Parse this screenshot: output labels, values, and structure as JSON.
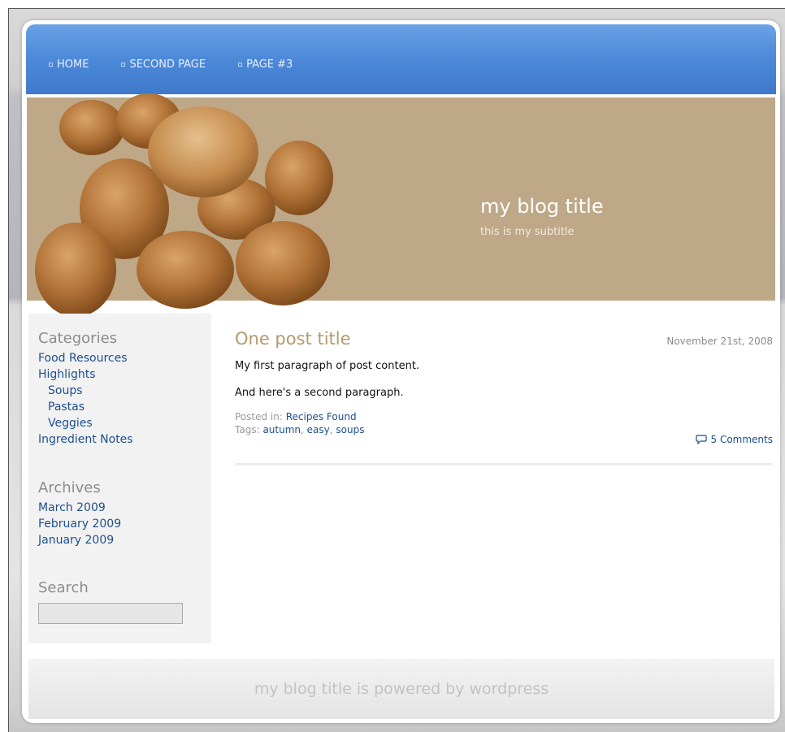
{
  "nav": {
    "items": [
      {
        "label": "HOME"
      },
      {
        "label": "SECOND PAGE"
      },
      {
        "label": "PAGE #3"
      }
    ]
  },
  "header": {
    "title": "my blog title",
    "subtitle": "this is my subtitle"
  },
  "sidebar": {
    "categories": {
      "title": "Categories",
      "items": [
        {
          "label": "Food Resources",
          "sub": false
        },
        {
          "label": "Highlights",
          "sub": false
        },
        {
          "label": "Soups",
          "sub": true
        },
        {
          "label": "Pastas",
          "sub": true
        },
        {
          "label": "Veggies",
          "sub": true
        },
        {
          "label": "Ingredient Notes",
          "sub": false
        }
      ]
    },
    "archives": {
      "title": "Archives",
      "items": [
        {
          "label": "March 2009"
        },
        {
          "label": "February 2009"
        },
        {
          "label": "January 2009"
        }
      ]
    },
    "search": {
      "title": "Search",
      "value": ""
    }
  },
  "post": {
    "title": "One post title",
    "date": "November 21st, 2008",
    "paragraphs": [
      "My first paragraph of post content.",
      "And here's a second paragraph."
    ],
    "posted_in_label": "Posted in:",
    "category": "Recipes Found",
    "tags_label": "Tags:",
    "tags": [
      "autumn",
      "easy",
      "soups"
    ],
    "comments": "5 Comments"
  },
  "footer": {
    "text": "my blog title is powered by wordpress"
  },
  "colors": {
    "nav_blue": "#4e8bd9",
    "banner_tan": "#bea887",
    "link_blue": "#1c4f8f",
    "title_tan": "#b49a6c"
  }
}
